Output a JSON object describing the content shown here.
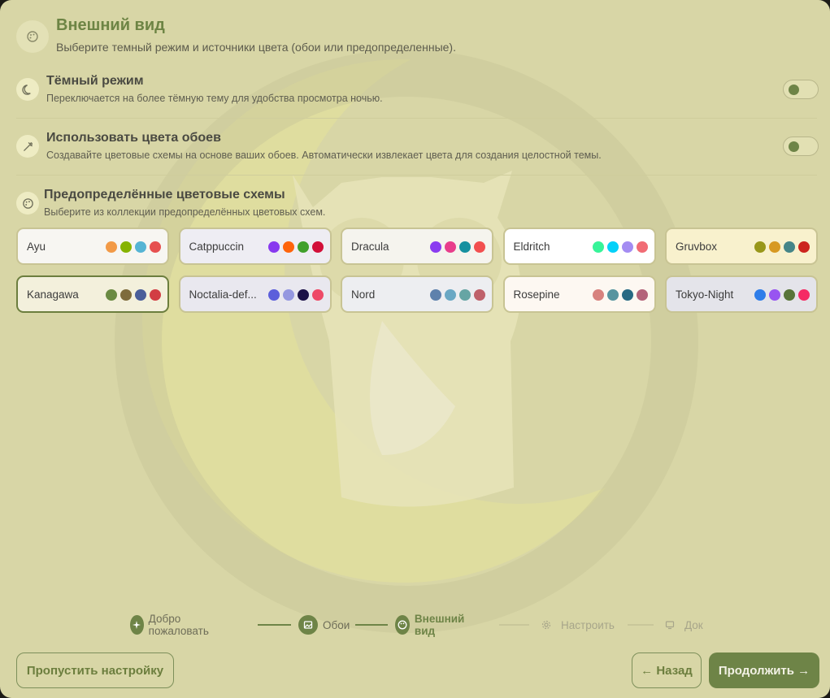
{
  "header": {
    "title": "Внешний вид",
    "subtitle": "Выберите темный режим и источники цвета (обои или предопределенные)."
  },
  "settings": {
    "dark_mode": {
      "title": "Тёмный режим",
      "description": "Переключается на более тёмную тему для удобства просмотра ночью.",
      "enabled": false
    },
    "wallpaper_colors": {
      "title": "Использовать цвета обоев",
      "description": "Создавайте цветовые схемы на основе ваших обоев. Автоматически извлекает цвета для создания целостной темы.",
      "enabled": false
    }
  },
  "schemes": {
    "title": "Предопределённые цветовые схемы",
    "description": "Выберите из коллекции предопределённых цветовых схем.",
    "selected": "Kanagawa",
    "items": [
      {
        "name": "Ayu",
        "bg": "#f7f6f2",
        "colors": [
          "#f29a47",
          "#86b300",
          "#55b4d4",
          "#e65050"
        ]
      },
      {
        "name": "Catppuccin",
        "bg": "#eeedf3",
        "colors": [
          "#8839ef",
          "#fe640b",
          "#40a02b",
          "#d20f39"
        ]
      },
      {
        "name": "Dracula",
        "bg": "#f5f4ee",
        "colors": [
          "#8a3cf0",
          "#e83e8c",
          "#16909f",
          "#f24f4f"
        ]
      },
      {
        "name": "Eldritch",
        "bg": "#ffffff",
        "colors": [
          "#37f499",
          "#04d1f9",
          "#a48cf2",
          "#f16c75"
        ]
      },
      {
        "name": "Gruvbox",
        "bg": "#f8f1cd",
        "colors": [
          "#98971a",
          "#d79921",
          "#458588",
          "#cc241d"
        ]
      },
      {
        "name": "Kanagawa",
        "bg": "#f3f0dc",
        "colors": [
          "#6a8a42",
          "#7e6b3c",
          "#4a5e9a",
          "#d23d44"
        ]
      },
      {
        "name": "Noctalia-def...",
        "bg": "#e9e8ef",
        "colors": [
          "#5c5fdb",
          "#9598e0",
          "#1c1247",
          "#ee4966"
        ]
      },
      {
        "name": "Nord",
        "bg": "#edeef1",
        "colors": [
          "#5e81ac",
          "#6aa8c4",
          "#66a5a4",
          "#bf616a"
        ]
      },
      {
        "name": "Rosepine",
        "bg": "#fdf8f2",
        "colors": [
          "#d7827e",
          "#56949f",
          "#286983",
          "#b4637a"
        ]
      },
      {
        "name": "Tokyo-Night",
        "bg": "#e4e4ea",
        "colors": [
          "#2e7de9",
          "#9854f1",
          "#587539",
          "#f52a65"
        ]
      }
    ]
  },
  "stepper": {
    "steps": [
      {
        "label": "Добро пожаловать",
        "icon": "sparkles-icon",
        "state": "done"
      },
      {
        "label": "Обои",
        "icon": "image-icon",
        "state": "done"
      },
      {
        "label": "Внешний вид",
        "icon": "palette-icon",
        "state": "current"
      },
      {
        "label": "Настроить",
        "icon": "gear-icon",
        "state": "upcoming"
      },
      {
        "label": "Док",
        "icon": "monitor-icon",
        "state": "upcoming"
      }
    ]
  },
  "footer": {
    "skip_label": "Пропустить настройку",
    "back_label": "← Назад",
    "continue_label": "Продолжить →"
  },
  "colors": {
    "accent": "#6e8447",
    "window_bg": "#d8d6a6",
    "muted": "#a7a58a"
  }
}
